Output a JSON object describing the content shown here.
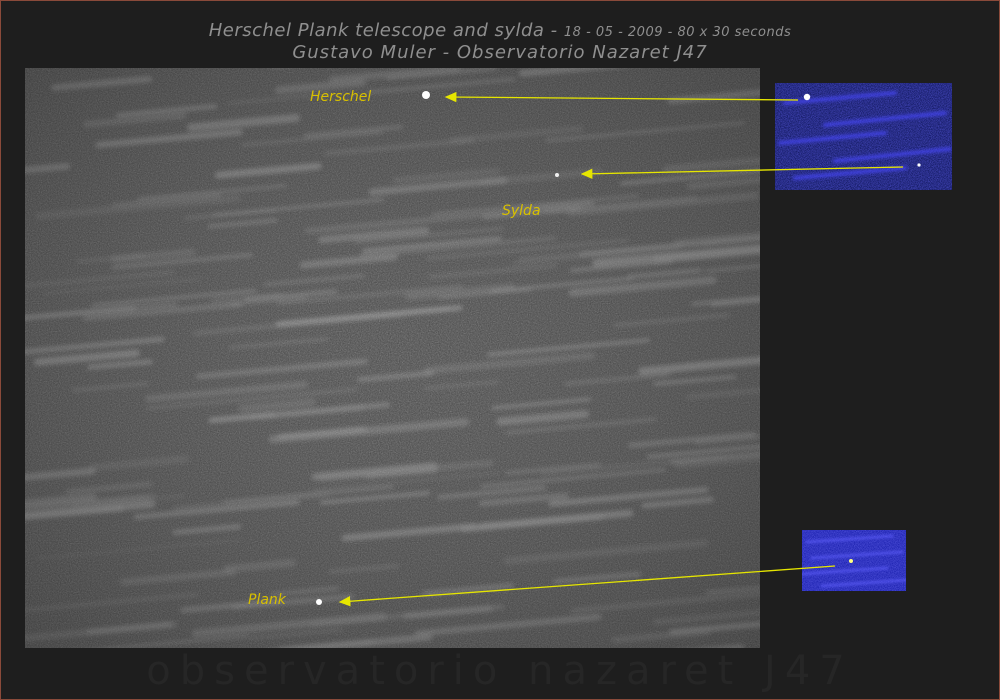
{
  "header": {
    "title_main": "Herschel Plank telescope and sylda",
    "title_dash": " - ",
    "title_details": "18 - 05 - 2009 - 80 x 30 seconds",
    "subtitle": "Gustavo Muler - Observatorio Nazaret J47"
  },
  "labels": {
    "herschel": "Herschel",
    "sylda": "Sylda",
    "plank": "Plank"
  },
  "watermark": "observatorio nazaret J47",
  "colors": {
    "background": "#1e1e1e",
    "border": "#8a4a3a",
    "title_text": "#8f8f8f",
    "label_text": "#d8c000",
    "arrow": "#e6e600",
    "inset_blue": "#1a1ab0"
  }
}
